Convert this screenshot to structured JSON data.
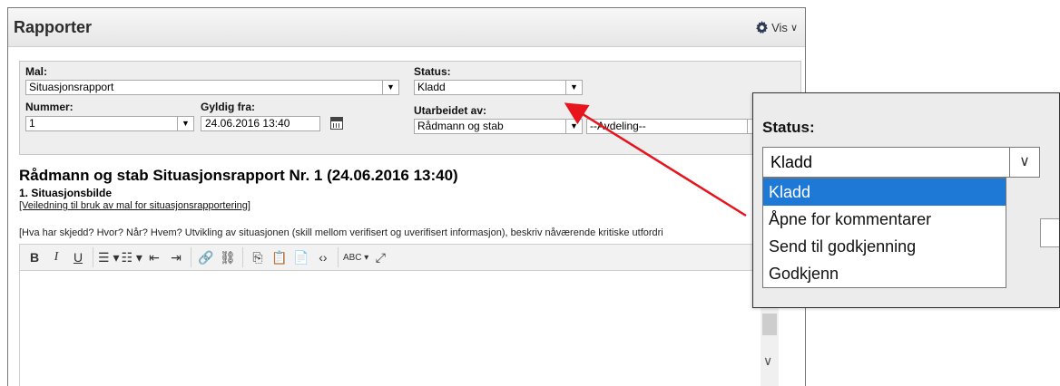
{
  "window": {
    "title": "Rapporter",
    "view_label": "Vis"
  },
  "form": {
    "template": {
      "label": "Mal:",
      "value": "Situasjonsrapport"
    },
    "status": {
      "label": "Status:",
      "value": "Kladd"
    },
    "number": {
      "label": "Nummer:",
      "value": "1"
    },
    "valid_from": {
      "label": "Gyldig fra:",
      "value": "24.06.2016 13:40"
    },
    "prepared_by": {
      "label": "Utarbeidet av:",
      "value": "Rådmann og stab",
      "department": "--Avdeling--"
    }
  },
  "report": {
    "title": "Rådmann og stab Situasjonsrapport Nr. 1 (24.06.2016 13:40)",
    "section": "1. Situasjonsbilde",
    "guide_link": "[Veiledning til bruk av mal for situasjonsrapportering]",
    "hint": "[Hva har skjedd? Hvor? Når? Hvem? Utvikling av situasjonen (skill mellom verifisert og uverifisert informasjon), beskriv nåværende kritiske utfordri"
  },
  "toolbar": {
    "bold": "B",
    "italic": "I",
    "underline": "U",
    "bullet_list": "☰ ▾",
    "numbered_list": "☷ ▾",
    "outdent": "⇤",
    "indent": "⇥",
    "link": "🔗",
    "unlink": "⛓",
    "copy": "⎘",
    "paste": "📋",
    "paste_text": "📄",
    "source": "‹›",
    "spellcheck": "ABC ▾",
    "maximize": "⤢"
  },
  "zoom": {
    "label": "Status:",
    "value": "Kladd",
    "options": [
      "Kladd",
      "Åpne for kommentarer",
      "Send til godkjenning",
      "Godkjenn"
    ],
    "selected_index": 0
  },
  "colors": {
    "highlight": "#1e79d6",
    "annotation_arrow": "#e8141b"
  }
}
